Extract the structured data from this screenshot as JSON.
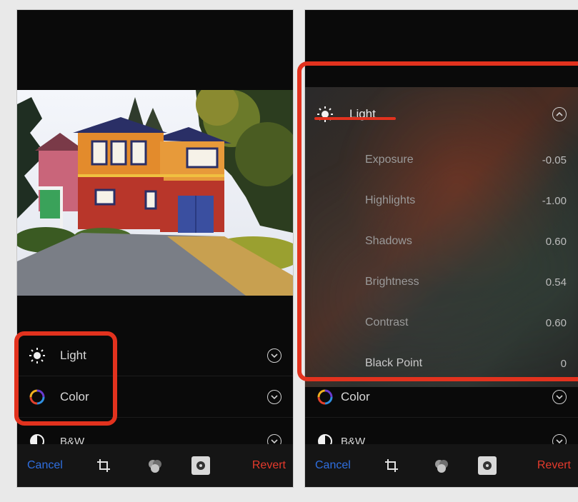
{
  "left_screen": {
    "adjustments": [
      {
        "label": "Light",
        "icon": "sun-icon"
      },
      {
        "label": "Color",
        "icon": "color-wheel-icon"
      },
      {
        "label": "B&W",
        "icon": "half-circle-icon"
      }
    ],
    "toolbar": {
      "cancel": "Cancel",
      "revert": "Revert"
    }
  },
  "right_screen": {
    "light_header": "Light",
    "light_sliders": [
      {
        "label": "Exposure",
        "value": "-0.05"
      },
      {
        "label": "Highlights",
        "value": "-1.00"
      },
      {
        "label": "Shadows",
        "value": "0.60"
      },
      {
        "label": "Brightness",
        "value": "0.54"
      },
      {
        "label": "Contrast",
        "value": "0.60"
      },
      {
        "label": "Black Point",
        "value": "0"
      }
    ],
    "other_adjustments": [
      {
        "label": "Color",
        "icon": "color-wheel-icon"
      },
      {
        "label": "B&W",
        "icon": "half-circle-icon"
      }
    ],
    "toolbar": {
      "cancel": "Cancel",
      "revert": "Revert"
    }
  },
  "colors": {
    "accent_blue": "#2f6fe0",
    "revert_red": "#e53a2c",
    "annotation_red": "#e2321e"
  }
}
